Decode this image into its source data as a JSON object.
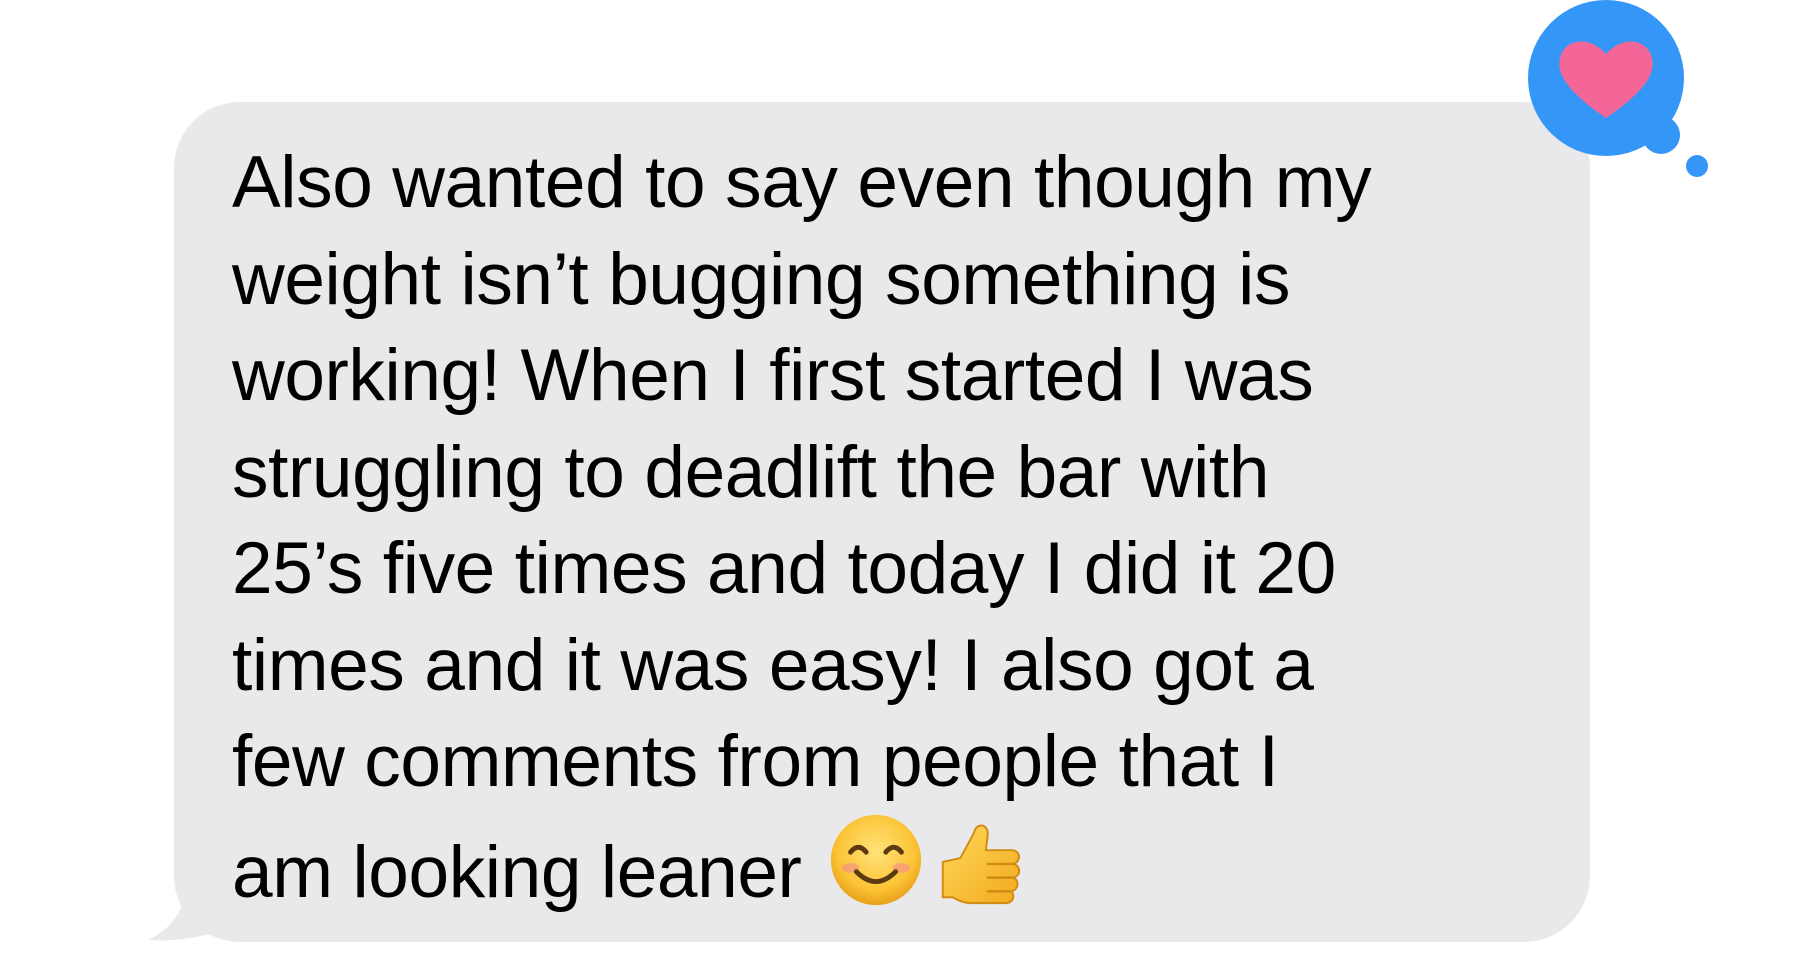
{
  "message": {
    "direction": "incoming",
    "text": "Also wanted to say even though my\nweight isn’t bugging something is\nworking! When I first started I was\nstruggling to deadlift the bar with\n25’s five times and today I did it 20\ntimes and it was easy! I also got a\nfew comments from people that I\nam looking leaner ",
    "emojis": [
      "smiling-face-icon",
      "thumbs-up-icon"
    ]
  },
  "tapback": {
    "reaction": "heart-icon",
    "bubble_color": "#3497f7",
    "heart_color": "#f46598"
  },
  "colors": {
    "bubble": "#e9e9eb",
    "text": "#000000",
    "background": "#ffffff"
  }
}
